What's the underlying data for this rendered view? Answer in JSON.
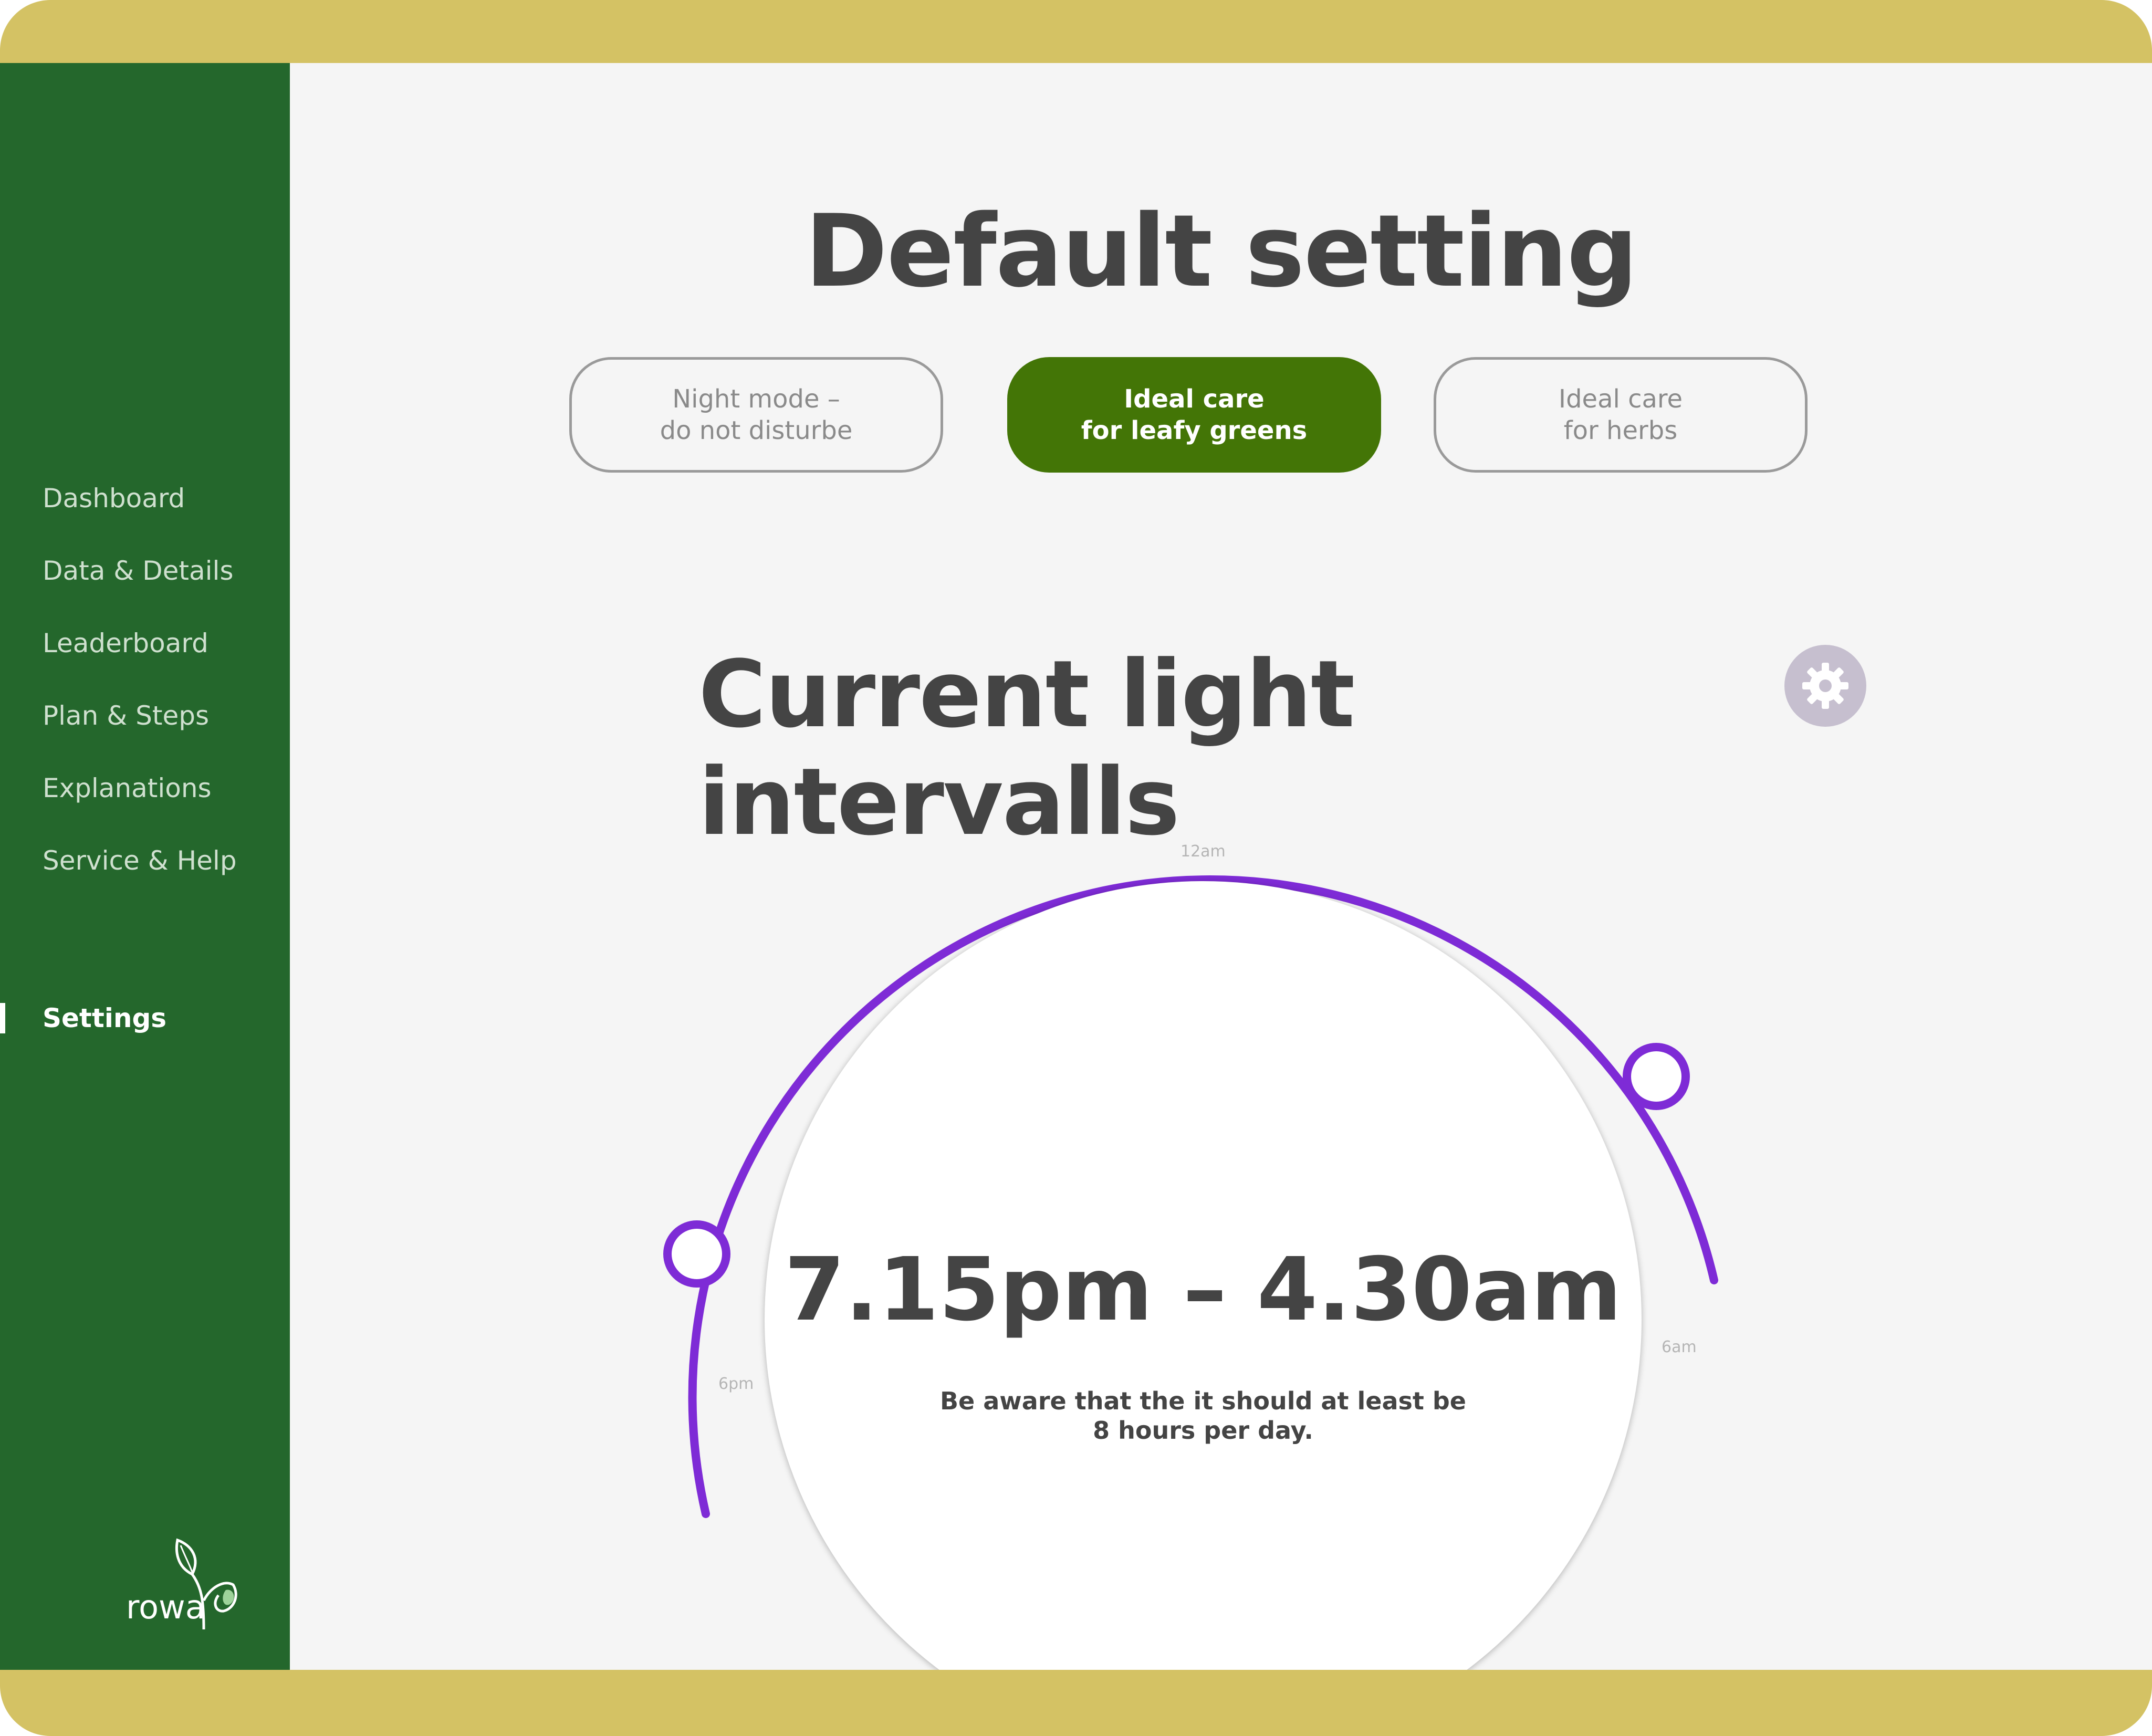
{
  "brand": {
    "name": "rowa",
    "logo_icon": "sprout-icon",
    "colors": {
      "frame": "#d4c264",
      "sidebar": "#24672c",
      "accent": "#437506",
      "dial": "#7e2bd6"
    }
  },
  "sidebar": {
    "items": [
      {
        "label": "Dashboard"
      },
      {
        "label": "Data & Details"
      },
      {
        "label": "Leaderboard"
      },
      {
        "label": "Plan & Steps"
      },
      {
        "label": "Explanations"
      },
      {
        "label": "Service & Help"
      }
    ],
    "settings_label": "Settings",
    "active": "Settings"
  },
  "default_setting": {
    "title": "Default setting",
    "presets": [
      {
        "line1": "Night mode –",
        "line2": "do not disturbe",
        "selected": false
      },
      {
        "line1": "Ideal care",
        "line2": "for leafy greens",
        "selected": true
      },
      {
        "line1": "Ideal care",
        "line2": "for herbs",
        "selected": false
      }
    ]
  },
  "light_intervals": {
    "title": "Current light intervalls",
    "settings_icon": "gear-icon",
    "hour_labels": {
      "top": "12am",
      "right": "6am",
      "left": "6pm"
    },
    "start": "7.15pm",
    "end": "4.30am",
    "range_text": "7.15pm – 4.30am",
    "hint_line1": "Be aware that the it should at least be",
    "hint_line2": "8 hours per day."
  }
}
